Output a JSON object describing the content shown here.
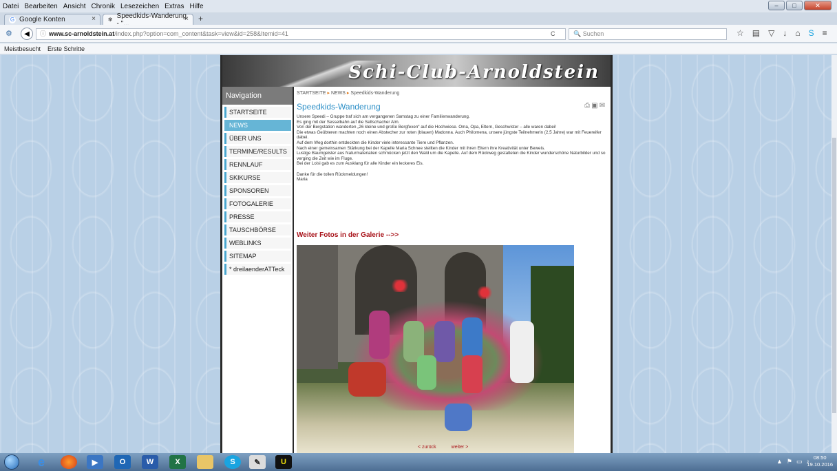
{
  "menubar": [
    "Datei",
    "Bearbeiten",
    "Ansicht",
    "Chronik",
    "Lesezeichen",
    "Extras",
    "Hilfe"
  ],
  "tabs": [
    {
      "label": "Google Konten",
      "icon": "G"
    },
    {
      "label": "Speedkids-Wanderung - \"...",
      "icon": "✾"
    }
  ],
  "url": {
    "host": "www.sc-arnoldstein.at",
    "path": "/index.php?option=com_content&task=view&id=258&Itemid=41"
  },
  "search_placeholder": "Suchen",
  "bookmarks": [
    "Meistbesucht",
    "Erste Schritte"
  ],
  "site": {
    "logo": "Schi-Club-Arnoldstein",
    "nav_heading": "Navigation",
    "nav_items": [
      "STARTSEITE",
      "NEWS",
      "ÜBER UNS",
      "TERMINE/RESULTS",
      "RENNLAUF",
      "SKIKURSE",
      "SPONSOREN",
      "FOTOGALERIE",
      "PRESSE",
      "TAUSCHBÖRSE",
      "WEBLINKS",
      "SITEMAP",
      "* dreilaenderATTeck"
    ],
    "active_nav": 1,
    "breadcrumb": [
      "STARTSEITE",
      "NEWS",
      "Speedkids-Wanderung"
    ]
  },
  "article": {
    "title": "Speedkids-Wanderung",
    "paragraphs": [
      "Unsere Speedi – Gruppe traf sich am vergangenen Samstag zu einer Familienwanderung.",
      "Es ging mit der Sesselbahn auf die Seltschacher Alm.",
      "Von der Bergstation wanderten „26 kleine und große Bergfexen“ auf die Hochwiese. Oma, Opa, Eltern, Geschwister – alle waren dabei!",
      "Die etwas Geübteren machten noch einen Abstecher zur roten (blauen) Madonna. Auch Philomena, unsere jüngste Teilnehmerin (2,5 Jahre) war mit Feuereifer dabei.",
      "Auf dem Weg dorthin entdeckten die Kinder viele interessante Tiere und Pflanzen.",
      "Nach einer gemeinsamen Stärkung bei der Kapelle Maria Schnee stellten die Kinder mit ihren Eltern ihre Kreativität unter Beweis.",
      "Lustige Baumgeister aus Naturmaterialien schmücken jetzt den Wald um die Kapelle. Auf dem Rückweg gestalteten die Kinder wunderschöne Naturbilder und so verging die Zeit wie im Fluge.",
      "Bei der Loisi gab es zum Ausklang für alle Kinder ein leckeres Eis.",
      "",
      "Danke für die tollen Rückmeldungen!",
      "Maria"
    ],
    "gallery_link": "Weiter Fotos in der Galerie -->>",
    "prev": "< zurück",
    "next": "weiter >"
  },
  "taskbar": {
    "time": "08:50",
    "date": "19.10.2016"
  }
}
